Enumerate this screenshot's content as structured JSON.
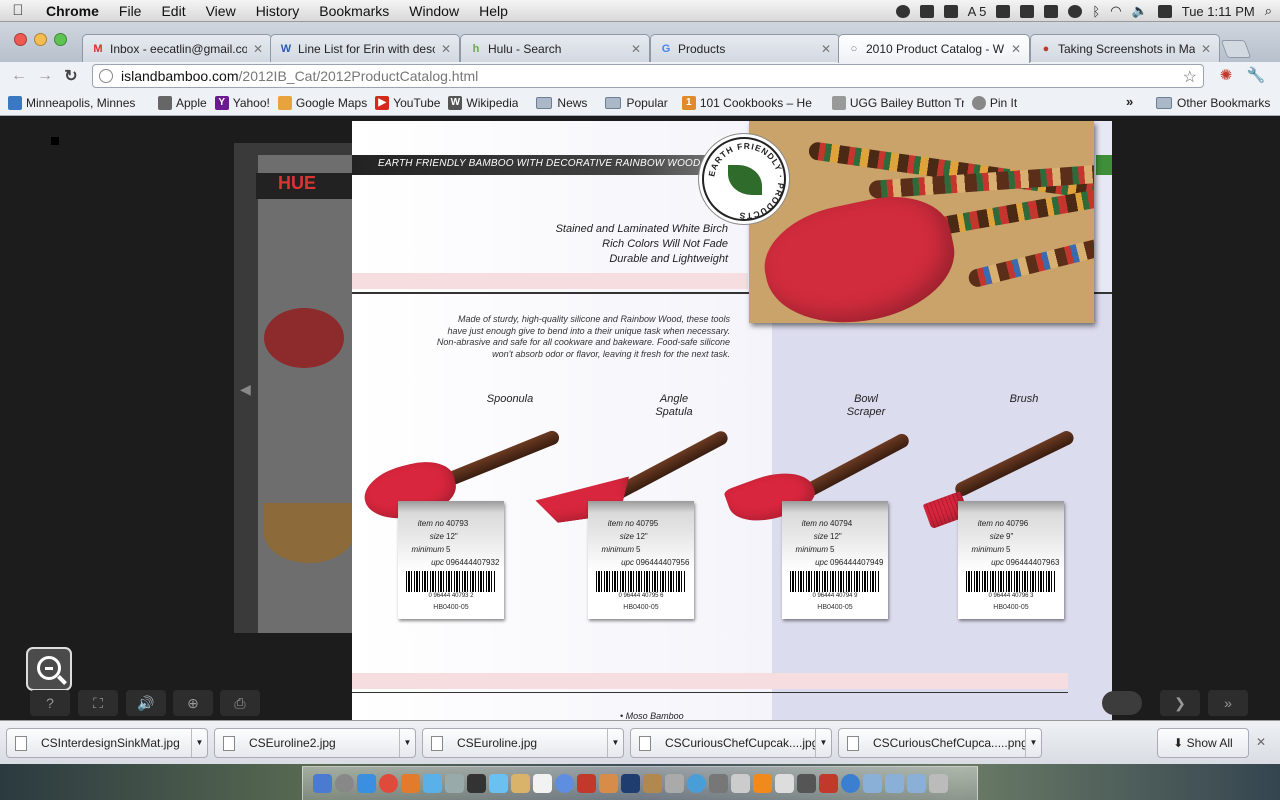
{
  "menubar": {
    "app": "Chrome",
    "items": [
      "File",
      "Edit",
      "View",
      "History",
      "Bookmarks",
      "Window",
      "Help"
    ],
    "status_badge": "5",
    "clock": "Tue 1:11 PM"
  },
  "tabs": [
    {
      "label": "Inbox - eecatlin@gmail.co",
      "favicon": "M",
      "color": "#d93025"
    },
    {
      "label": "Line List for Erin with desc",
      "favicon": "W",
      "color": "#2a5db0"
    },
    {
      "label": "Hulu - Search",
      "favicon": "h",
      "color": "#6aa84f"
    },
    {
      "label": "Products",
      "favicon": "G",
      "color": "#4285f4"
    },
    {
      "label": "2010 Product Catalog - W",
      "favicon": "○",
      "color": "#777777"
    },
    {
      "label": "Taking Screenshots in Mac",
      "favicon": "●",
      "color": "#c0392b"
    }
  ],
  "address": {
    "domain": "islandbamboo.com",
    "path": "/2012IB_Cat/2012ProductCatalog.html"
  },
  "bookmarks": [
    {
      "label": "Minneapolis, Minnes",
      "type": "link",
      "color": "#3a78c3"
    },
    {
      "label": "Apple",
      "type": "link",
      "color": "#666666"
    },
    {
      "label": "Yahoo!",
      "type": "link",
      "color": "#6b1b8f"
    },
    {
      "label": "Google Maps",
      "type": "link",
      "color": "#e8a33d"
    },
    {
      "label": "YouTube",
      "type": "link",
      "color": "#d6281e"
    },
    {
      "label": "Wikipedia",
      "type": "link",
      "color": "#555555"
    },
    {
      "label": "News",
      "type": "folder"
    },
    {
      "label": "Popular",
      "type": "folder"
    },
    {
      "label": "101 Cookbooks – He",
      "type": "link",
      "color": "#e08a2c"
    },
    {
      "label": "UGG Bailey Button Tr",
      "type": "link",
      "color": "#999999"
    },
    {
      "label": "Pin It",
      "type": "link",
      "color": "#888888"
    }
  ],
  "other_bookmarks": "Other Bookmarks",
  "catalog": {
    "banner": "EARTH FRIENDLY BAMBOO WITH DECORATIVE RAINBOW WOOD ACCENTS",
    "badge_text": "EARTH FRIENDLY · PRODUCTS",
    "features": [
      "Stained and Laminated White Birch",
      "Rich Colors Will Not Fade",
      "Durable and Lightweight"
    ],
    "description": [
      "Made of sturdy, high-quality silicone and Rainbow Wood, these tools",
      "have just enough give to bend into a their unique task when necessary.",
      "Non-abrasive and safe for all cookware and bakeware. Food-safe silicone",
      "won't absorb odor or flavor, leaving it fresh for the next task."
    ],
    "labels": {
      "item": "item no",
      "size": "size",
      "minimum": "minimum",
      "upc": "upc"
    },
    "products": [
      {
        "name": "Spoonula",
        "item_no": "40793",
        "size": "12\"",
        "minimum": "5",
        "upc": "096444407932",
        "upc_short": "0 96444 40793 2",
        "code": "HB0400-05"
      },
      {
        "name": "Angle Spatula",
        "item_no": "40795",
        "size": "12\"",
        "minimum": "5",
        "upc": "096444407956",
        "upc_short": "0 96444 40795 6",
        "code": "HB0400-05"
      },
      {
        "name": "Bowl Scraper",
        "item_no": "40794",
        "size": "12\"",
        "minimum": "5",
        "upc": "096444407949",
        "upc_short": "0 96444 40794 9",
        "code": "HB0400-05"
      },
      {
        "name": "Brush",
        "item_no": "40796",
        "size": "9\"",
        "minimum": "5",
        "upc": "096444407963",
        "upc_short": "0 96444 40796 3",
        "code": "HB0400-05"
      }
    ],
    "footer_bullet": "• Moso Bamboo",
    "side_page_logo": "HUE"
  },
  "viewer": {
    "controls": [
      "?",
      "⛶",
      "🔊",
      "⊕",
      "⎙"
    ],
    "next": "❯",
    "last": "»"
  },
  "downloads": {
    "items": [
      "CSInterdesignSinkMat.jpg",
      "CSEuroline2.jpg",
      "CSEuroline.jpg",
      "CSCuriousChefCupcak....jpg",
      "CSCuriousChefCupca.....png"
    ],
    "show_all": "Show All"
  },
  "colors": {
    "silicone_red": "#d7263d",
    "wood_brown": "#5a2e18",
    "banner_black": "#222222",
    "accent_green": "#3e8e3a"
  }
}
